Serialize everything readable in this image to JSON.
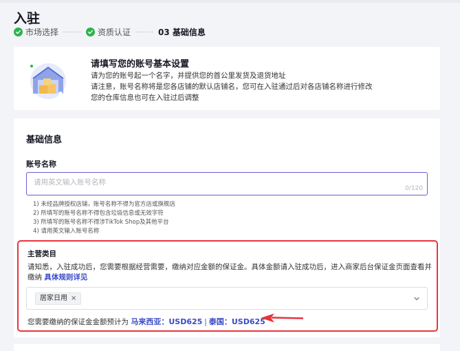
{
  "page": {
    "title": "入驻"
  },
  "steps": [
    {
      "label": "市场选择",
      "status": "done"
    },
    {
      "label": "资质认证",
      "status": "done"
    },
    {
      "label": "03 基础信息",
      "status": "current"
    }
  ],
  "intro": {
    "title": "请填写您的账号基本设置",
    "lines": [
      "请为您的账号起一个名字，并提供您的首公里发货及退货地址",
      "请注意，账号名称将是您各店铺的默认店铺名，您可在入驻通过后对各店铺名称进行修改",
      "您的仓库信息也可在入驻过后调整"
    ],
    "illustration": "warehouse-icon"
  },
  "form": {
    "section_title": "基础信息",
    "account_name": {
      "label": "账号名称",
      "placeholder": "请用英文输入账号名称",
      "value": "",
      "counter": "0/120"
    },
    "hints": [
      "1) 未经品牌授权店铺，账号名称不得为官方店或旗舰店",
      "2) 所填写的账号名称不得包含垃圾信息或无效字符",
      "3) 所填写的账号名称不得涉TikTok Shop及其他平台",
      "4) 请用英文输入账号名称"
    ],
    "category": {
      "label": "主营类目",
      "description": "请知悉，入驻成功后，您需要根据经营需要，缴纳对应金额的保证金。具体金额请入驻成功后，进入商家后台保证金页面查看并缴纳",
      "rules_link": "具体规则详见",
      "selected_tag": "居家日用",
      "tag_remove": "×",
      "deposit_prefix": "您需要缴纳的保证金金额预计为",
      "deposit_my": "马来西亚：USD625",
      "deposit_sep": "|",
      "deposit_th": "泰国：USD625"
    }
  },
  "colors": {
    "accent": "#3a4ac7",
    "success": "#2bb44a",
    "highlight": "#e8333a",
    "input_border": "#6b5cd8"
  }
}
